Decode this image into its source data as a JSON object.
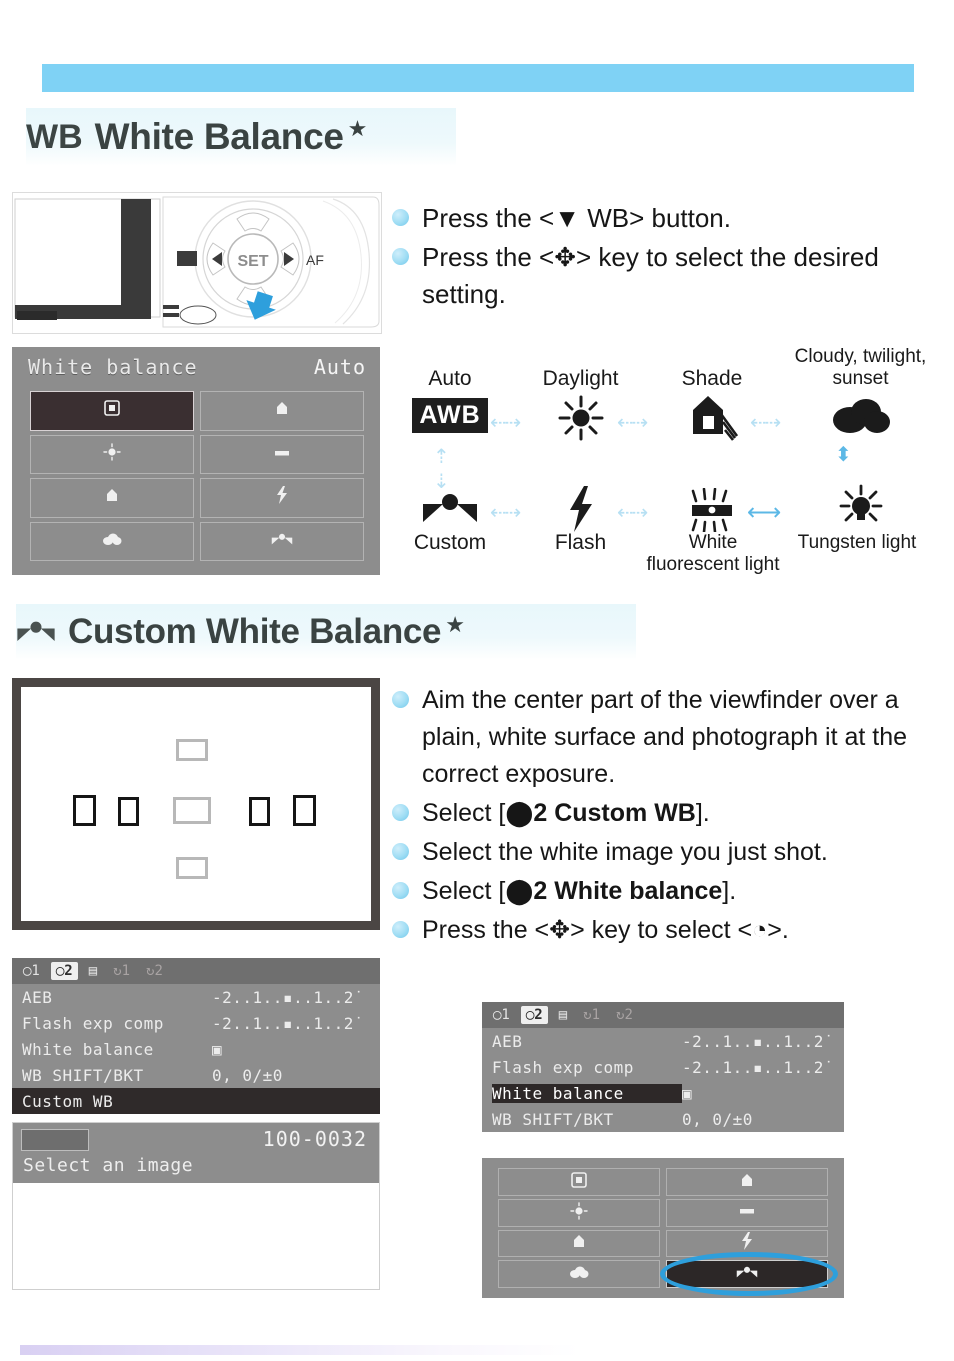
{
  "page": {
    "accent_blue": "#7fd2f5",
    "heading_bg": "#e8f7fb",
    "highlight_ring": "#2e9fdc"
  },
  "section1": {
    "icon": "WB",
    "title": "White Balance",
    "star": "★",
    "steps": [
      {
        "text_html": "Press the <▼ WB> button."
      },
      {
        "text_html": "Press the <✥> key to select the desired setting."
      }
    ],
    "camera_figure": {
      "set_button": "SET",
      "left_button": "◀",
      "right_button": "▶",
      "right_label": "AF",
      "arrow_color": "#2e9fdc"
    },
    "lcd": {
      "title": "White balance",
      "value": "Auto",
      "cells": [
        {
          "icon": "awb-icon",
          "glyph": "▣",
          "selected": true
        },
        {
          "icon": "shade-icon",
          "glyph": "⌂",
          "selected": false
        },
        {
          "icon": "daylight-icon",
          "glyph": "☀",
          "selected": false
        },
        {
          "icon": "fluorescent-icon",
          "glyph": "▬",
          "selected": false
        },
        {
          "icon": "shade-house-icon",
          "glyph": "⌂",
          "selected": false
        },
        {
          "icon": "flash-icon",
          "glyph": "⚡",
          "selected": false
        },
        {
          "icon": "cloudy-icon",
          "glyph": "☁",
          "selected": false
        },
        {
          "icon": "custom-wb-icon",
          "glyph": "◔",
          "selected": false
        }
      ]
    },
    "wb_matrix": {
      "labels_top": [
        "Auto",
        "Daylight",
        "Shade",
        "Cloudy, twilight, sunset"
      ],
      "labels_bottom": [
        "Custom",
        "Flash",
        "White fluorescent light",
        "Tungsten light"
      ],
      "icons_top": [
        "AWB",
        "daylight-sun-icon",
        "shade-house-icon",
        "cloud-icon"
      ],
      "icons_bottom": [
        "custom-wb-icon",
        "flash-bolt-icon",
        "fluorescent-tube-icon",
        "tungsten-bulb-icon"
      ],
      "awb_label": "AWB"
    }
  },
  "section2": {
    "icon": "custom-wb-icon",
    "title": "Custom White Balance",
    "star": "★",
    "steps": [
      {
        "text_html": "Aim the center part of the viewfinder over a plain, white surface and photograph it at the correct exposure."
      },
      {
        "text_html": "Select [<b>⬤︎2 Custom WB</b>]."
      },
      {
        "text_html": "Select the white image you just shot."
      },
      {
        "text_html": "Select [<b>⬤︎2 White balance</b>]."
      },
      {
        "text_html": "Press the <✥> key to select <◔>."
      }
    ],
    "viewfinder": {
      "af_point_count": 7
    },
    "menu_left": {
      "tabs": [
        "◯1",
        "◯2",
        "▤",
        "↻1",
        "↻2"
      ],
      "active_tab_index": 1,
      "rows": [
        {
          "label": "AEB",
          "value": "-2..1..▪..1..2˙",
          "highlight": false
        },
        {
          "label": "Flash exp comp",
          "value": "-2..1..▪..1..2˙",
          "highlight": false
        },
        {
          "label": "White balance",
          "value": "▣",
          "highlight": false
        },
        {
          "label": "WB SHIFT/BKT",
          "value": "0, 0/±0",
          "highlight": false
        },
        {
          "label": "Custom WB",
          "value": "",
          "highlight": true
        }
      ]
    },
    "image_select": {
      "file_number": "100-0032",
      "caption": "Select an image"
    },
    "menu_right": {
      "tabs": [
        "◯1",
        "◯2",
        "▤",
        "↻1",
        "↻2"
      ],
      "active_tab_index": 1,
      "rows": [
        {
          "label": "AEB",
          "value": "-2..1..▪..1..2˙",
          "selected": false
        },
        {
          "label": "Flash exp comp",
          "value": "-2..1..▪..1..2˙",
          "selected": false
        },
        {
          "label": "White balance",
          "value": "▣",
          "selected": true
        },
        {
          "label": "WB SHIFT/BKT",
          "value": "0, 0/±0",
          "selected": false
        }
      ]
    },
    "wb_grid_right": {
      "cells": [
        {
          "icon": "awb-icon",
          "glyph": "▣",
          "selected": false
        },
        {
          "icon": "shade-icon",
          "glyph": "⌂",
          "selected": false
        },
        {
          "icon": "daylight-icon",
          "glyph": "☀",
          "selected": false
        },
        {
          "icon": "fluorescent-icon",
          "glyph": "▬",
          "selected": false
        },
        {
          "icon": "shade-house-icon",
          "glyph": "⌂",
          "selected": false
        },
        {
          "icon": "flash-icon",
          "glyph": "⚡",
          "selected": false
        },
        {
          "icon": "cloudy-icon",
          "glyph": "☁",
          "selected": false
        },
        {
          "icon": "custom-wb-icon",
          "glyph": "◔",
          "selected": true
        }
      ],
      "highlight_note": "custom-wb-circled"
    }
  }
}
